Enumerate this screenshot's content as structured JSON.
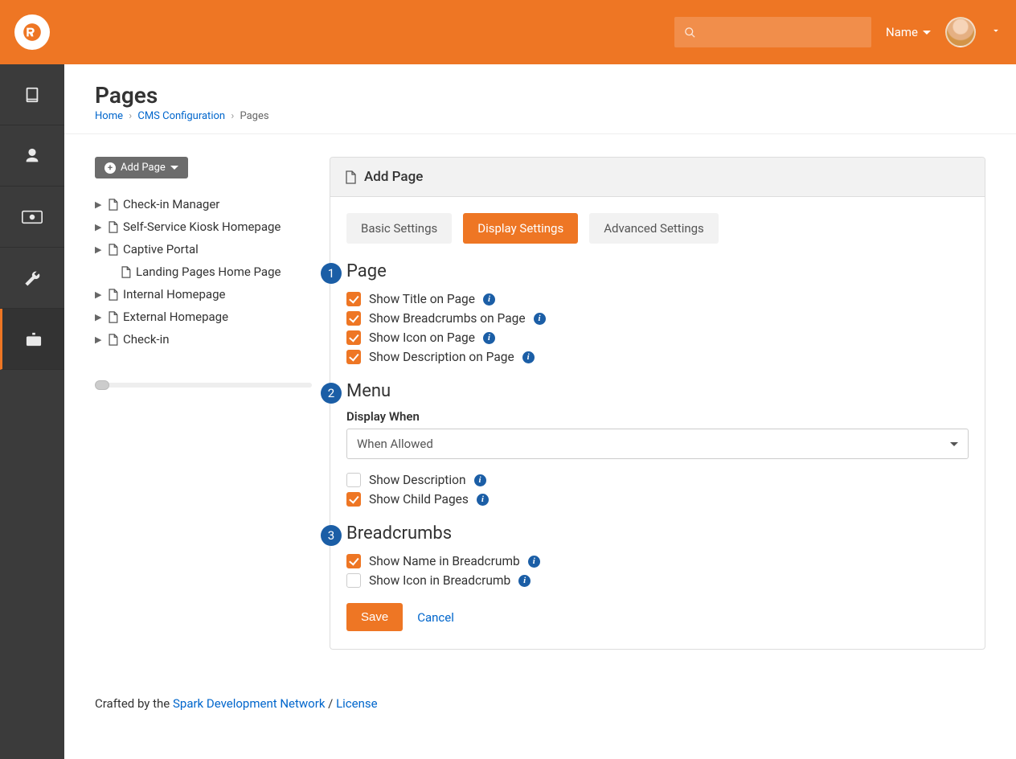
{
  "topbar": {
    "search_placeholder": "",
    "name_menu": "Name"
  },
  "page_header": {
    "title": "Pages",
    "breadcrumbs": [
      {
        "label": "Home",
        "link": true
      },
      {
        "label": "CMS Configuration",
        "link": true
      },
      {
        "label": "Pages",
        "link": false
      }
    ]
  },
  "tree": {
    "add_btn": "Add Page",
    "items": [
      {
        "label": "Check-in Manager",
        "expandable": true
      },
      {
        "label": "Self-Service Kiosk Homepage",
        "expandable": true
      },
      {
        "label": "Captive Portal",
        "expandable": true
      },
      {
        "label": "Landing Pages Home Page",
        "expandable": false
      },
      {
        "label": "Internal Homepage",
        "expandable": true
      },
      {
        "label": "External Homepage",
        "expandable": true
      },
      {
        "label": "Check-in",
        "expandable": true
      }
    ]
  },
  "panel": {
    "title": "Add Page",
    "tabs": [
      {
        "label": "Basic Settings",
        "active": false
      },
      {
        "label": "Display Settings",
        "active": true
      },
      {
        "label": "Advanced Settings",
        "active": false
      }
    ],
    "sections": {
      "page": {
        "num": "1",
        "title": "Page",
        "checks": [
          {
            "label": "Show Title on Page",
            "checked": true,
            "info": true
          },
          {
            "label": "Show Breadcrumbs on Page",
            "checked": true,
            "info": true
          },
          {
            "label": "Show Icon on Page",
            "checked": true,
            "info": true
          },
          {
            "label": "Show Description on Page",
            "checked": true,
            "info": true
          }
        ]
      },
      "menu": {
        "num": "2",
        "title": "Menu",
        "display_when_label": "Display When",
        "display_when_value": "When Allowed",
        "checks": [
          {
            "label": "Show Description",
            "checked": false,
            "info": true
          },
          {
            "label": "Show Child Pages",
            "checked": true,
            "info": true
          }
        ]
      },
      "breadcrumbs": {
        "num": "3",
        "title": "Breadcrumbs",
        "checks": [
          {
            "label": "Show Name in Breadcrumb",
            "checked": true,
            "info": true
          },
          {
            "label": "Show Icon in Breadcrumb",
            "checked": false,
            "info": true
          }
        ]
      }
    },
    "save": "Save",
    "cancel": "Cancel"
  },
  "footer": {
    "prefix": "Crafted by the ",
    "link1": "Spark Development Network",
    "sep": " / ",
    "link2": "License"
  }
}
